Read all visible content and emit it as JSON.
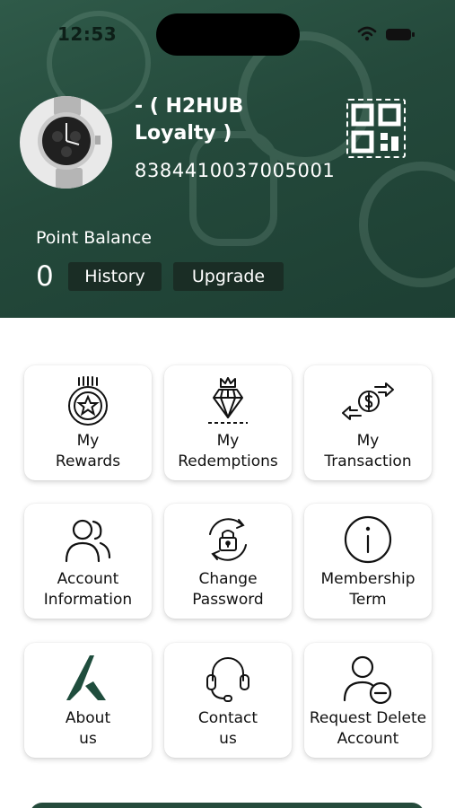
{
  "status_bar": {
    "time": "12:53"
  },
  "profile": {
    "name": "- ( H2HUB\nLoyalty )",
    "member_number": "8384410037005001"
  },
  "points": {
    "label": "Point Balance",
    "value": "0",
    "history_label": "History",
    "upgrade_label": "Upgrade"
  },
  "menu": [
    {
      "label": "My\nRewards",
      "icon": "reward-medal-icon"
    },
    {
      "label": "My\nRedemptions",
      "icon": "diamond-crown-icon"
    },
    {
      "label": "My\nTransaction",
      "icon": "money-exchange-icon"
    },
    {
      "label": "Account\nInformation",
      "icon": "users-icon"
    },
    {
      "label": "Change\nPassword",
      "icon": "lock-refresh-icon"
    },
    {
      "label": "Membership\nTerm",
      "icon": "info-icon"
    },
    {
      "label": "About\nus",
      "icon": "brand-logo-icon"
    },
    {
      "label": "Contact\nus",
      "icon": "headset-icon"
    },
    {
      "label": "Request Delete\nAccount",
      "icon": "user-remove-icon"
    }
  ],
  "colors": {
    "header_green": "#24493b",
    "pill_dark": "#1a2d25",
    "brand_green": "#1f4d3d"
  }
}
